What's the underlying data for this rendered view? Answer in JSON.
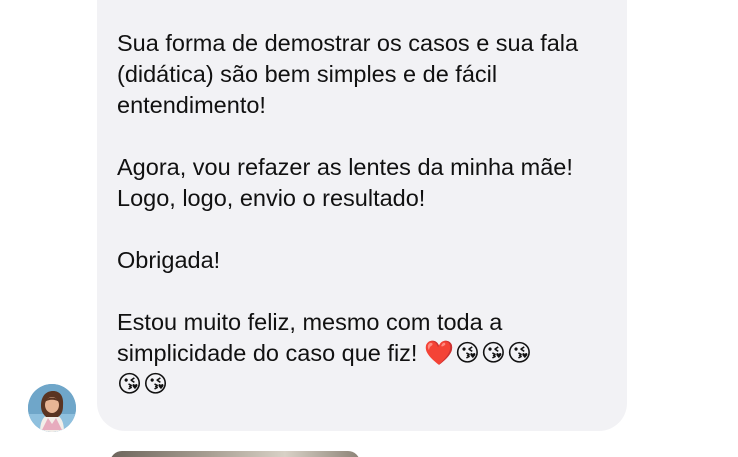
{
  "conversation": {
    "message": {
      "paragraphs": [
        "Sua forma de demostrar os casos e sua fala\n(didática) são bem simples e de fácil\nentendimento!",
        "Agora, vou refazer as lentes da minha mãe!\nLogo, logo, envio o resultado!",
        "Obrigada!",
        "Estou muito feliz, mesmo com toda a\nsimplicidade do caso que fiz! "
      ],
      "emojis": "❤️😘😘😘\n😘😘"
    },
    "sender": {
      "avatar_icon": "profile-photo-woman"
    }
  },
  "colors": {
    "bubble_background": "#f2f2f5",
    "text": "#111111",
    "page_background": "#ffffff"
  }
}
